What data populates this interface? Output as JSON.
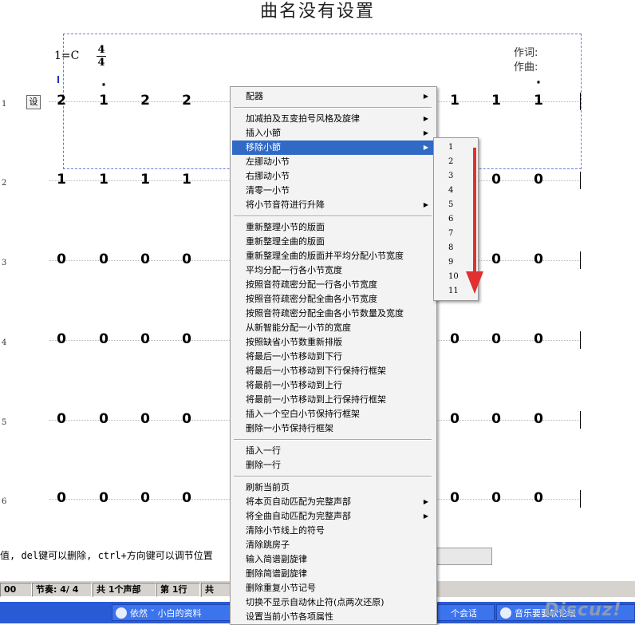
{
  "title": "曲名没有设置",
  "header": {
    "key": "1=C",
    "ts_top": "4",
    "ts_bottom": "4",
    "lyric_label": "作词:",
    "composer_label": "作曲:",
    "set_button": "设"
  },
  "rows": [
    {
      "num": "1",
      "left": [
        "2",
        "1",
        "2",
        "2"
      ],
      "left_dots": [
        false,
        true,
        false,
        false
      ],
      "right": [
        "1",
        "1",
        "1"
      ],
      "right_dots": [
        false,
        false,
        true
      ]
    },
    {
      "num": "2",
      "left": [
        "1",
        "1",
        "1",
        "1"
      ],
      "right": [
        "0",
        "0"
      ]
    },
    {
      "num": "3",
      "left": [
        "0",
        "0",
        "0",
        "0"
      ],
      "right": [
        "0",
        "0",
        "0"
      ]
    },
    {
      "num": "4",
      "left": [
        "0",
        "0",
        "0",
        "0"
      ],
      "right": [
        "0",
        "0",
        "0"
      ]
    },
    {
      "num": "5",
      "left": [
        "0",
        "0",
        "0",
        "0"
      ],
      "right": [
        "0",
        "0",
        "0"
      ]
    },
    {
      "num": "6",
      "left": [
        "0",
        "0",
        "0",
        "0"
      ],
      "right": [
        "0",
        "0",
        "0"
      ]
    }
  ],
  "status_message": "值, del键可以删除, ctrl+方向键可以调节位置",
  "status_bar": [
    "00",
    "节奏: 4/ 4",
    "共 1个声部",
    "第 1行",
    "共"
  ],
  "taskbar": {
    "task1": "依然 ˇ 小白的资料",
    "task2": "个会话",
    "task3": "音乐要要软论坛"
  },
  "watermark": "Discuz!",
  "menu": {
    "items": [
      {
        "label": "配器",
        "sub": true
      },
      {
        "sep": true
      },
      {
        "label": "加减拍及五变拍号风格及旋律",
        "sub": true
      },
      {
        "label": "插入小節",
        "sub": true
      },
      {
        "label": "移除小節",
        "sub": true,
        "hl": true
      },
      {
        "label": "左挪动小节"
      },
      {
        "label": "右挪动小节"
      },
      {
        "label": "清零一小节"
      },
      {
        "label": "将小节音符进行升降",
        "sub": true
      },
      {
        "sep": true
      },
      {
        "label": "重新整理小节的版面"
      },
      {
        "label": "重新整理全曲的版面"
      },
      {
        "label": "重新整理全曲的版面并平均分配小节宽度"
      },
      {
        "label": "平均分配一行各小节宽度"
      },
      {
        "label": "按照音符疏密分配一行各小节宽度"
      },
      {
        "label": "按照音符疏密分配全曲各小节宽度"
      },
      {
        "label": "按照音符疏密分配全曲各小节数量及宽度"
      },
      {
        "label": "从新智能分配一小节的宽度"
      },
      {
        "label": "按照缺省小节数重新排版"
      },
      {
        "label": "将最后一小节移动到下行"
      },
      {
        "label": "将最后一小节移动到下行保持行框架"
      },
      {
        "label": "将最前一小节移动到上行"
      },
      {
        "label": "将最前一小节移动到上行保持行框架"
      },
      {
        "label": "插入一个空白小节保持行框架"
      },
      {
        "label": "删除一小节保持行框架"
      },
      {
        "sep": true
      },
      {
        "label": "插入一行"
      },
      {
        "label": "删除一行"
      },
      {
        "sep": true
      },
      {
        "label": "刷新当前页"
      },
      {
        "label": "将本页自动匹配为完整声部",
        "sub": true
      },
      {
        "label": "将全曲自动匹配为完整声部",
        "sub": true
      },
      {
        "label": "清除小节线上的符号"
      },
      {
        "label": "清除跳房子"
      },
      {
        "label": "输入简谱副旋律"
      },
      {
        "label": "删除简谱副旋律"
      },
      {
        "label": "删除重复小节记号"
      },
      {
        "label": "切换不显示自动休止符(点两次还原)"
      },
      {
        "label": "设置当前小节各项属性"
      }
    ]
  },
  "submenu": {
    "items": [
      "1",
      "2",
      "3",
      "4",
      "5",
      "6",
      "7",
      "8",
      "9",
      "10",
      "11"
    ]
  },
  "colors": {
    "highlight": "#316ac5",
    "arrow": "#e03030",
    "frame": "#6f79d6"
  }
}
